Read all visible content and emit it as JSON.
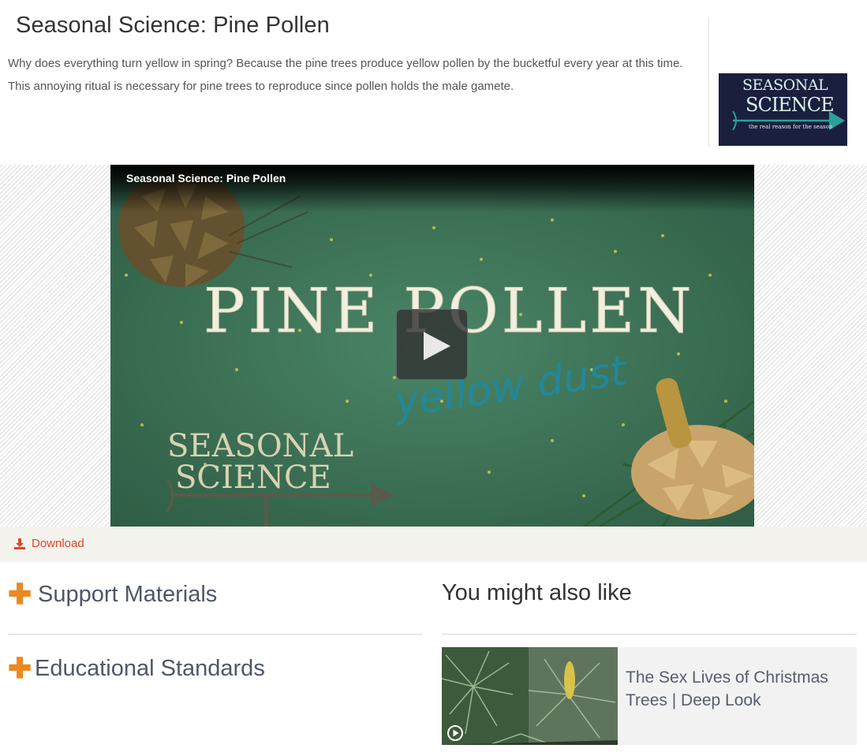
{
  "header": {
    "title": "Seasonal Science: Pine Pollen",
    "description": "Why does everything turn yellow in spring? Because the pine trees produce yellow pollen by the bucketful every year at this time. This annoying ritual is necessary for pine trees to reproduce since pollen holds the male gamete."
  },
  "thumbnail": {
    "line1": "SEASONAL",
    "line2": "SCIENCE",
    "tagline": "the real reason for the season",
    "icon": "seasonal-science-logo"
  },
  "video": {
    "title": "Seasonal Science: Pine Pollen",
    "poster_title": "PINE POLLEN",
    "poster_subtitle": "and yellow dust",
    "poster_brand_1": "SEASONAL",
    "poster_brand_2": "SCIENCE",
    "play_icon": "play-icon"
  },
  "download": {
    "label": "Download",
    "icon": "download-icon",
    "color": "#e0442a"
  },
  "accordion": {
    "support_label": "Support Materials",
    "standards_label": "Educational Standards",
    "plus_color": "#e98a24"
  },
  "related": {
    "heading": "You might also like",
    "items": [
      {
        "title": "The Sex Lives of Christmas Trees | Deep Look",
        "icon": "video-play-icon"
      }
    ]
  }
}
